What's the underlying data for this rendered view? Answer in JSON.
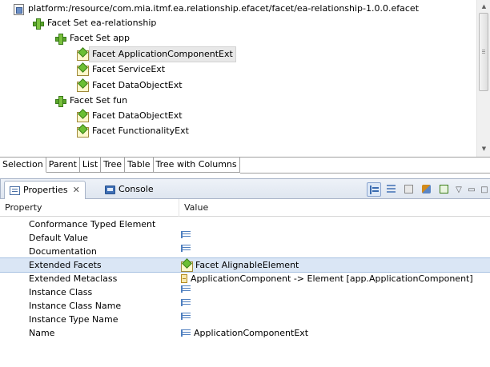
{
  "tree": {
    "items": [
      {
        "label": "platform:/resource/com.mia.itmf.ea.relationship.efacet/facet/ea-relationship-1.0.0.efacet",
        "icon": "resource-icon"
      },
      {
        "label": "Facet Set ea-relationship",
        "icon": "facet-set-icon"
      },
      {
        "label": "Facet Set app",
        "icon": "facet-set-icon"
      },
      {
        "label": "Facet ApplicationComponentExt",
        "icon": "facet-icon",
        "selected": true
      },
      {
        "label": "Facet ServiceExt",
        "icon": "facet-icon"
      },
      {
        "label": "Facet DataObjectExt",
        "icon": "facet-icon"
      },
      {
        "label": "Facet Set fun",
        "icon": "facet-set-icon"
      },
      {
        "label": "Facet DataObjectExt",
        "icon": "facet-icon"
      },
      {
        "label": "Facet FunctionalityExt",
        "icon": "facet-icon"
      }
    ]
  },
  "view_tabs": [
    "Selection",
    "Parent",
    "List",
    "Tree",
    "Table",
    "Tree with Columns"
  ],
  "panel": {
    "tabs": [
      {
        "label": "Properties",
        "icon": "properties-icon",
        "close": "✕",
        "active": true
      },
      {
        "label": "Console",
        "icon": "console-icon",
        "active": false
      }
    ],
    "toolbar": {
      "icons": [
        "show-categories-icon",
        "show-advanced-icon",
        "filter-icon",
        "restore-default-icon",
        "pin-icon"
      ],
      "view_menu": "▽",
      "minimize": "▭",
      "maximize": "□"
    }
  },
  "properties": {
    "columns": [
      "Property",
      "Value"
    ],
    "rows": [
      {
        "name": "Conformance Typed Element",
        "value": "",
        "icon": ""
      },
      {
        "name": "Default Value",
        "value": "",
        "icon": "text-value-icon"
      },
      {
        "name": "Documentation",
        "value": "",
        "icon": "text-value-icon"
      },
      {
        "name": "Extended Facets",
        "value": "Facet AlignableElement",
        "icon": "facet-icon",
        "selected": true
      },
      {
        "name": "Extended Metaclass",
        "value": "ApplicationComponent -> Element [app.ApplicationComponent]",
        "icon": "eclass-icon"
      },
      {
        "name": "Instance Class",
        "value": "",
        "icon": "text-value-icon"
      },
      {
        "name": "Instance Class Name",
        "value": "",
        "icon": "text-value-icon"
      },
      {
        "name": "Instance Type Name",
        "value": "",
        "icon": "text-value-icon"
      },
      {
        "name": "Name",
        "value": "ApplicationComponentExt",
        "icon": "text-value-icon"
      }
    ]
  },
  "colors": {
    "selection_row": "#dae6f5",
    "panel_header": "#dfe6f0",
    "facet_green": "#6cbf34"
  }
}
